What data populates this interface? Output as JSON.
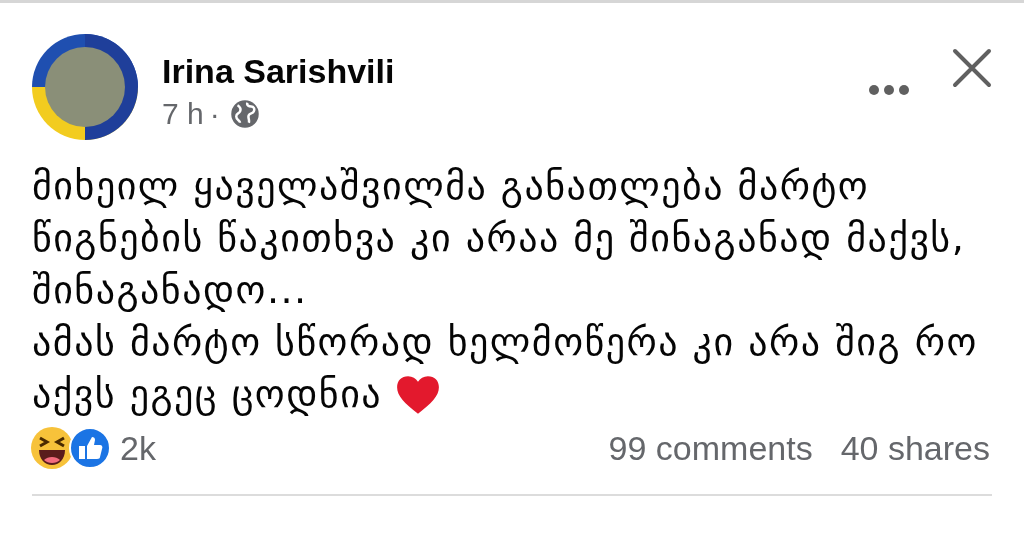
{
  "post": {
    "author": "Irina Sarishvili",
    "time": "7 h",
    "separator": "·",
    "lines": [
      {
        "text": "მიხეილ ყაველაშვილმა განათლება მარტო",
        "heart": false
      },
      {
        "text": "წიგნების წაკითხვა კი არაა მე შინაგანად მაქვს,",
        "heart": false
      },
      {
        "text": "შინაგანადო...",
        "heart": false
      },
      {
        "text": "ამას მარტო სწორად ხელმოწერა კი არა შიგ რო",
        "heart": false
      },
      {
        "text": "აქვს ეგეც ცოდნია",
        "heart": true
      }
    ]
  },
  "footer": {
    "reactions_count": "2k",
    "comments": "99 comments",
    "shares": "40 shares"
  }
}
